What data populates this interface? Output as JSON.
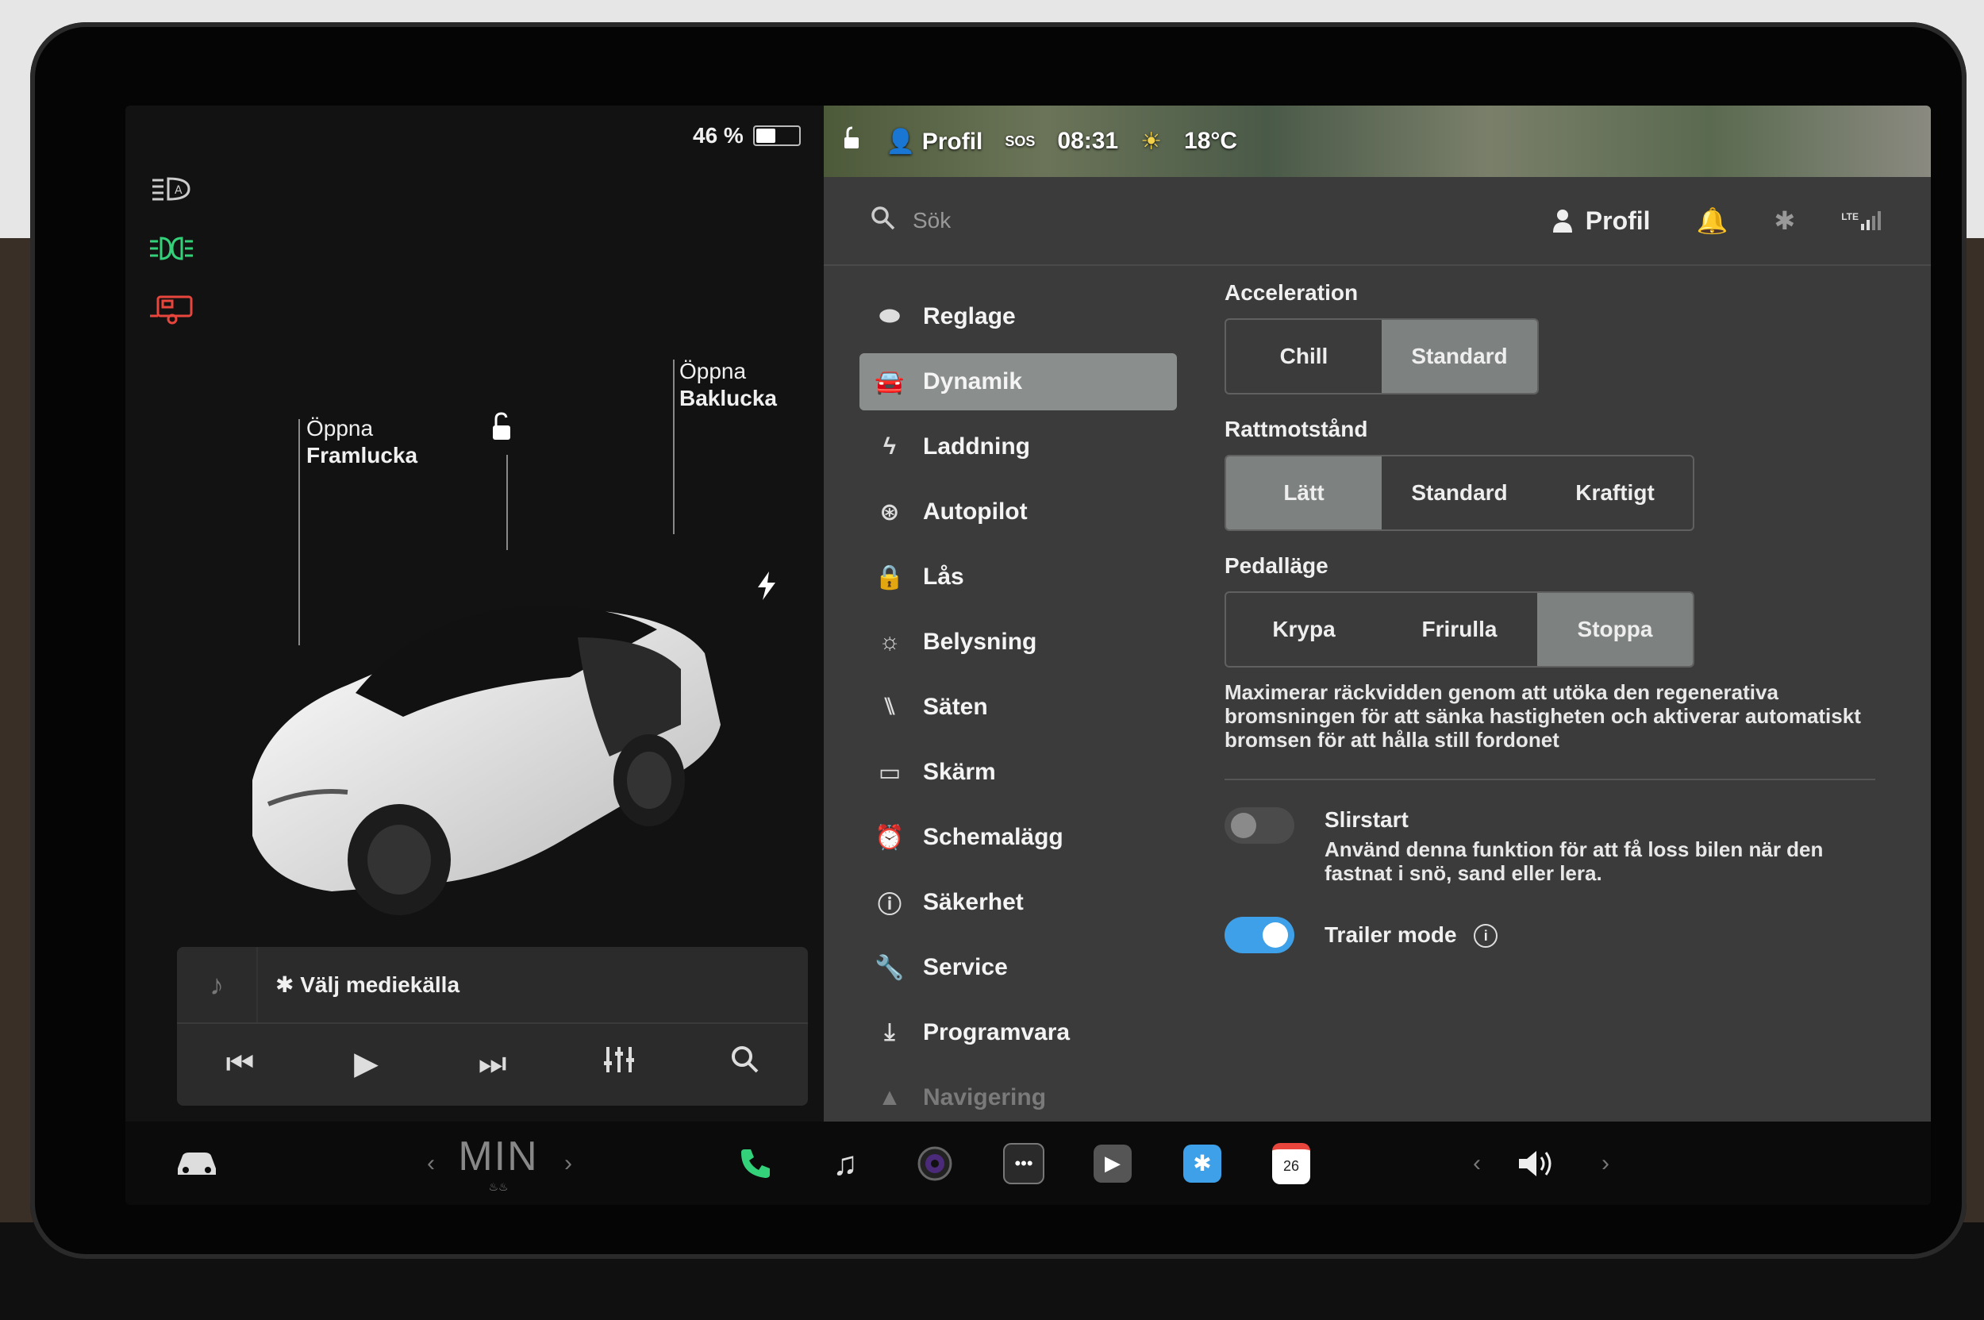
{
  "vehicle": {
    "battery_percent": "46 %",
    "battery_level": 0.46,
    "callouts": {
      "front_line1": "Öppna",
      "front_line2": "Framlucka",
      "rear_line1": "Öppna",
      "rear_line2": "Baklucka"
    },
    "indicators": [
      "auto-headlight-icon",
      "parking-light-icon",
      "trailer-icon"
    ],
    "indicator_colors": {
      "parking": "#33d17a",
      "trailer": "#e8463d"
    }
  },
  "media": {
    "source_label": "✱ Välj mediekälla",
    "controls": [
      "prev-icon",
      "play-icon",
      "next-icon",
      "equalizer-icon",
      "search-icon"
    ]
  },
  "status": {
    "profile": "Profil",
    "sos": "SOS",
    "time": "08:31",
    "temperature": "18°C"
  },
  "topbar": {
    "search_placeholder": "Sök",
    "profile": "Profil",
    "lte": "LTE"
  },
  "menu": {
    "items": [
      {
        "label": "Reglage"
      },
      {
        "label": "Dynamik"
      },
      {
        "label": "Laddning"
      },
      {
        "label": "Autopilot"
      },
      {
        "label": "Lås"
      },
      {
        "label": "Belysning"
      },
      {
        "label": "Säten"
      },
      {
        "label": "Skärm"
      },
      {
        "label": "Schemalägg"
      },
      {
        "label": "Säkerhet"
      },
      {
        "label": "Service"
      },
      {
        "label": "Programvara"
      },
      {
        "label": "Navigering"
      }
    ],
    "active": "Dynamik"
  },
  "dynamics": {
    "acceleration": {
      "title": "Acceleration",
      "options": [
        "Chill",
        "Standard"
      ],
      "selected": "Standard"
    },
    "steering": {
      "title": "Rattmotstånd",
      "options": [
        "Lätt",
        "Standard",
        "Kraftigt"
      ],
      "selected": "Lätt"
    },
    "pedal": {
      "title": "Pedalläge",
      "options": [
        "Krypa",
        "Frirulla",
        "Stoppa"
      ],
      "selected": "Stoppa",
      "description": "Maximerar räckvidden genom att utöka den regenerativa bromsningen för att sänka hastigheten och aktiverar automatiskt bromsen för att hålla still fordonet"
    },
    "slip_start": {
      "title": "Slirstart",
      "description": "Använd denna funktion för att få loss bilen när den fastnat i snö, sand eller lera.",
      "enabled": false
    },
    "trailer_mode": {
      "title": "Trailer mode",
      "enabled": true
    }
  },
  "dock": {
    "climate": "MIN",
    "calendar_day": "26",
    "accent_blue": "#3ea0e8",
    "phone_green": "#33d17a"
  }
}
